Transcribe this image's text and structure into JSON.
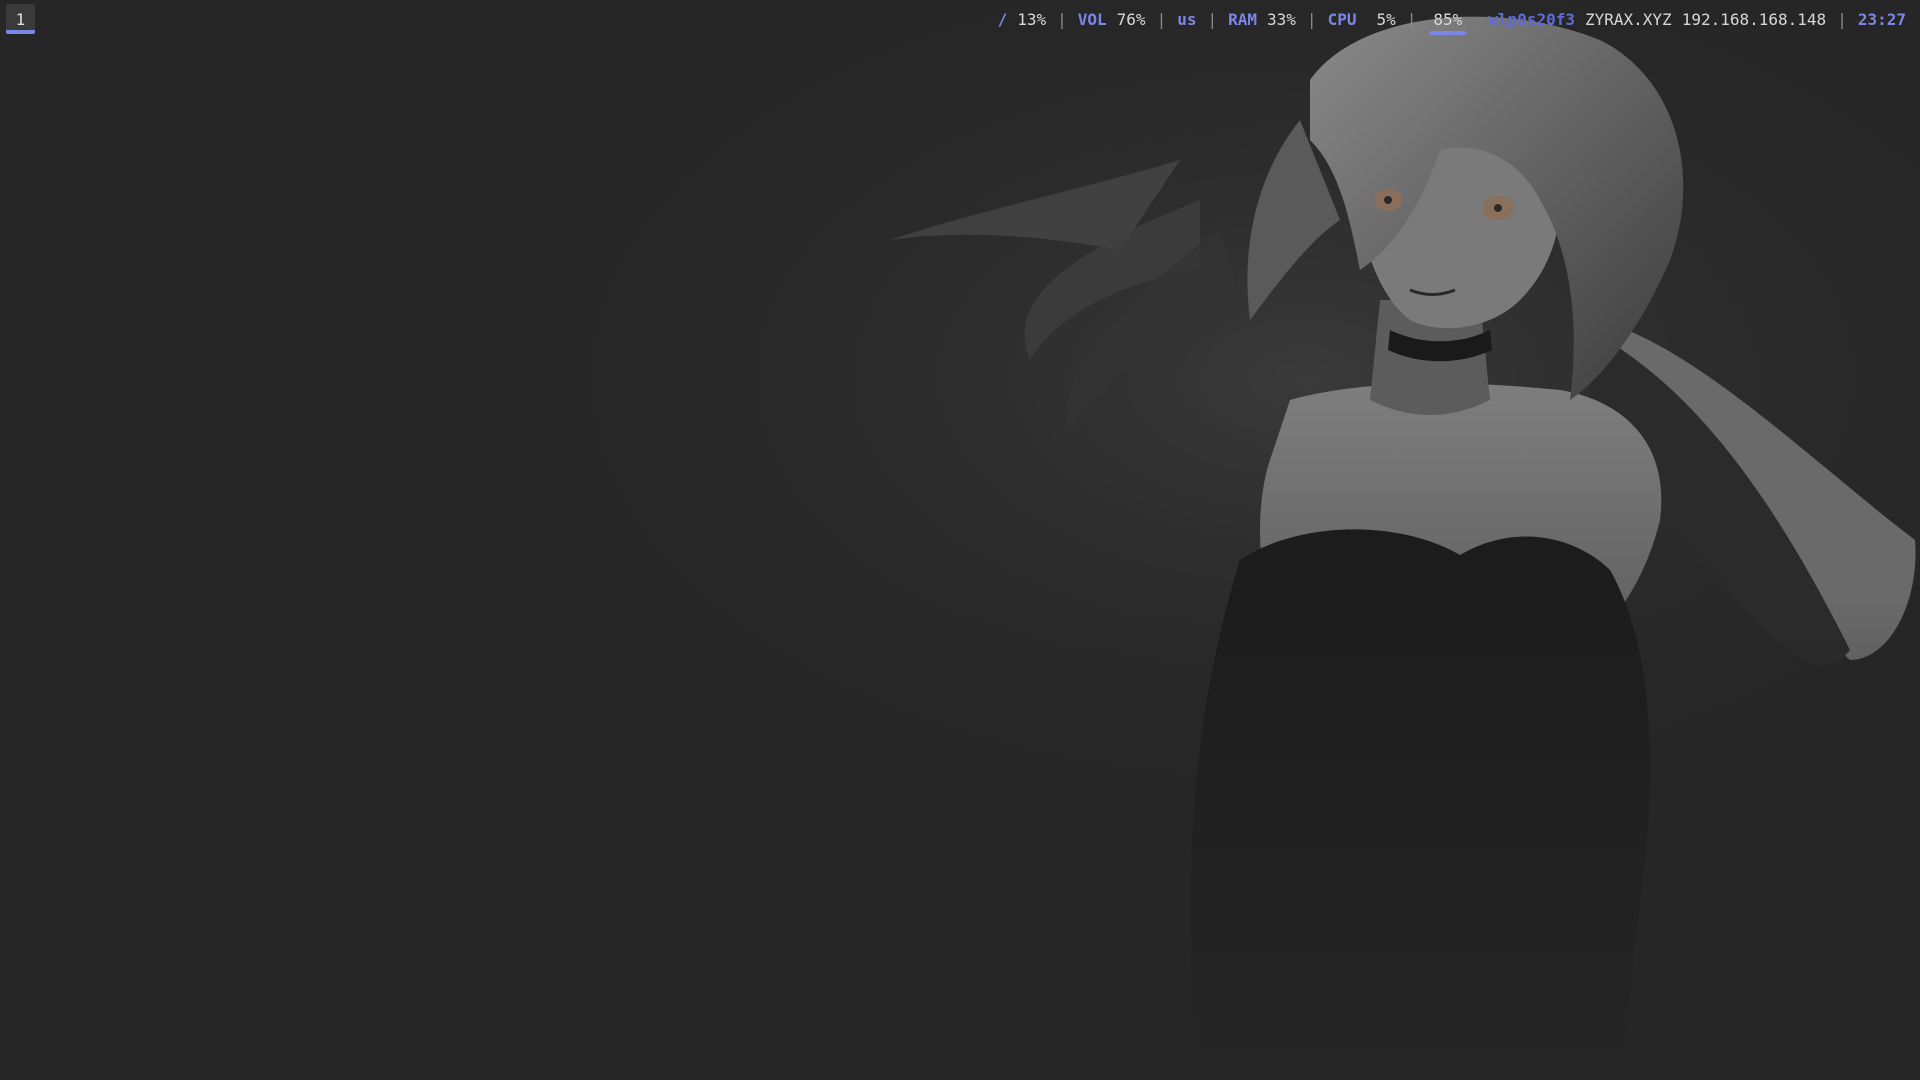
{
  "workspace": {
    "label": "1"
  },
  "status": {
    "disk_label": "/",
    "disk_value": "13%",
    "vol_label": "VOL",
    "vol_value": "76%",
    "kbd_layout": "us",
    "ram_label": "RAM",
    "ram_value": "33%",
    "cpu_label": "CPU",
    "cpu_value": "5%",
    "battery_value": "85%",
    "net_iface": "wlp0s20f3",
    "net_ssid": "ZYRAX.XYZ",
    "net_ip": "192.168.168.148",
    "clock": "23:27",
    "separator": "|"
  },
  "colors": {
    "background": "#262626",
    "accent": "#7b86e8",
    "text": "#d8d8d8"
  }
}
